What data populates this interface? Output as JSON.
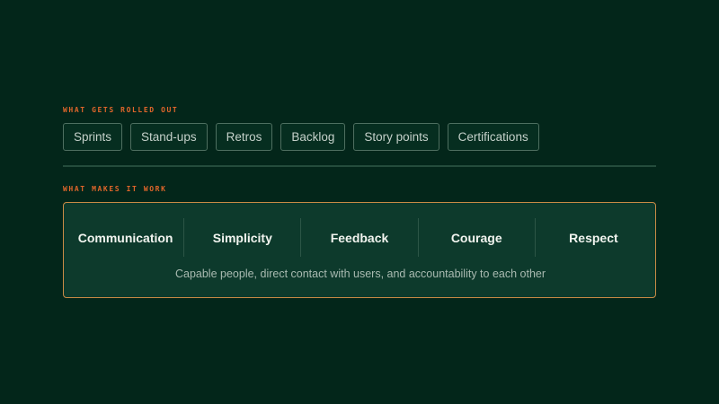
{
  "rolled_out": {
    "label": "WHAT GETS ROLLED OUT",
    "items": [
      "Sprints",
      "Stand-ups",
      "Retros",
      "Backlog",
      "Story points",
      "Certifications"
    ]
  },
  "makes_it_work": {
    "label": "WHAT MAKES IT WORK",
    "values": [
      "Communication",
      "Simplicity",
      "Feedback",
      "Courage",
      "Respect"
    ],
    "caption": "Capable people, direct contact with users, and accountability to each other"
  },
  "colors": {
    "background": "#03261a",
    "accent": "#e0662b",
    "card_border": "#c98a45",
    "card_fill": "#0d3a2c"
  }
}
